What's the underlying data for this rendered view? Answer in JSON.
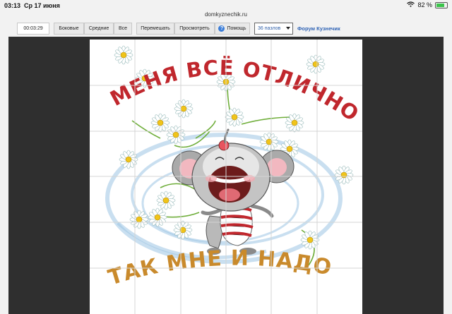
{
  "statusbar": {
    "time": "03:13",
    "date": "Ср 17 июня",
    "url": "domkyznechik.ru",
    "battery_text": "82 %",
    "battery_level": 0.82
  },
  "toolbar": {
    "timer": "00:03:29",
    "side_label": "Боковые",
    "middle_label": "Средние",
    "all_label": "Все",
    "shuffle_label": "Перемешать",
    "view_label": "Просмотреть",
    "help_label": "Помощь",
    "pieces_select": "36 пазлов",
    "forum_link": "Форум Кузнечик"
  },
  "puzzle": {
    "caption_top": "У МЕНЯ ВСЁ ОТЛИЧНО,",
    "caption_bottom": "ТАК МНЕ И НАДО!",
    "top_color": "#c0272d",
    "bottom_color": "#c98a2c"
  }
}
